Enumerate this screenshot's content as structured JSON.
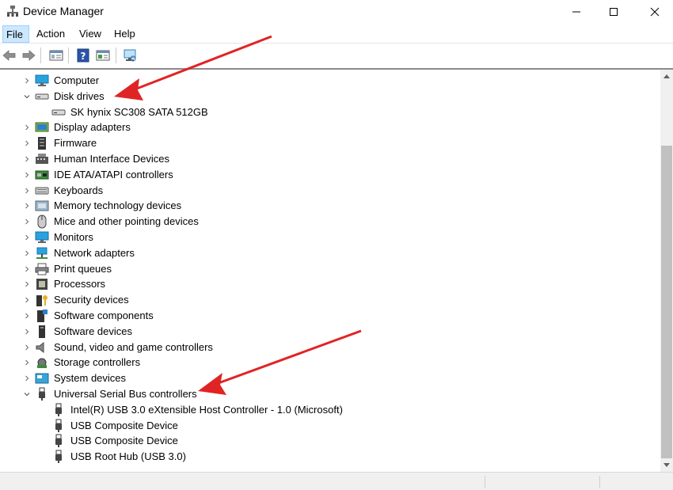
{
  "window": {
    "title": "Device Manager",
    "icon": "device-manager-icon",
    "controls": [
      "minimize",
      "maximize",
      "close"
    ]
  },
  "menu": [
    {
      "label": "File",
      "active": true
    },
    {
      "label": "Action",
      "active": false
    },
    {
      "label": "View",
      "active": false
    },
    {
      "label": "Help",
      "active": false
    }
  ],
  "toolbar": {
    "buttons": [
      "back-icon",
      "forward-icon",
      "properties-icon",
      "help-icon",
      "show-hidden-icon",
      "scan-hardware-icon"
    ]
  },
  "tree": [
    {
      "label": "Computer",
      "icon": "computer-icon",
      "expanded": false,
      "level": 1
    },
    {
      "label": "Disk drives",
      "icon": "disk-drive-icon",
      "expanded": true,
      "level": 1
    },
    {
      "label": "SK hynix SC308 SATA 512GB",
      "icon": "disk-drive-icon",
      "level": 2
    },
    {
      "label": "Display adapters",
      "icon": "display-adapter-icon",
      "expanded": false,
      "level": 1
    },
    {
      "label": "Firmware",
      "icon": "firmware-icon",
      "expanded": false,
      "level": 1
    },
    {
      "label": "Human Interface Devices",
      "icon": "hid-icon",
      "expanded": false,
      "level": 1
    },
    {
      "label": "IDE ATA/ATAPI controllers",
      "icon": "ide-controller-icon",
      "expanded": false,
      "level": 1
    },
    {
      "label": "Keyboards",
      "icon": "keyboard-icon",
      "expanded": false,
      "level": 1
    },
    {
      "label": "Memory technology devices",
      "icon": "memory-device-icon",
      "expanded": false,
      "level": 1
    },
    {
      "label": "Mice and other pointing devices",
      "icon": "mouse-icon",
      "expanded": false,
      "level": 1
    },
    {
      "label": "Monitors",
      "icon": "monitor-icon",
      "expanded": false,
      "level": 1
    },
    {
      "label": "Network adapters",
      "icon": "network-adapter-icon",
      "expanded": false,
      "level": 1
    },
    {
      "label": "Print queues",
      "icon": "printer-icon",
      "expanded": false,
      "level": 1
    },
    {
      "label": "Processors",
      "icon": "processor-icon",
      "expanded": false,
      "level": 1
    },
    {
      "label": "Security devices",
      "icon": "security-device-icon",
      "expanded": false,
      "level": 1
    },
    {
      "label": "Software components",
      "icon": "software-component-icon",
      "expanded": false,
      "level": 1
    },
    {
      "label": "Software devices",
      "icon": "software-device-icon",
      "expanded": false,
      "level": 1
    },
    {
      "label": "Sound, video and game controllers",
      "icon": "speaker-icon",
      "expanded": false,
      "level": 1
    },
    {
      "label": "Storage controllers",
      "icon": "storage-controller-icon",
      "expanded": false,
      "level": 1
    },
    {
      "label": "System devices",
      "icon": "system-device-icon",
      "expanded": false,
      "level": 1
    },
    {
      "label": "Universal Serial Bus controllers",
      "icon": "usb-icon",
      "expanded": true,
      "level": 1
    },
    {
      "label": "Intel(R) USB 3.0 eXtensible Host Controller - 1.0 (Microsoft)",
      "icon": "usb-icon",
      "level": 2
    },
    {
      "label": "USB Composite Device",
      "icon": "usb-icon",
      "level": 2
    },
    {
      "label": "USB Composite Device",
      "icon": "usb-icon",
      "level": 2
    },
    {
      "label": "USB Root Hub (USB 3.0)",
      "icon": "usb-icon",
      "level": 2
    }
  ],
  "colors": {
    "annotation_arrow": "#e02424",
    "menu_active_bg": "#cce8ff",
    "accent_blue": "#1e90d6"
  }
}
